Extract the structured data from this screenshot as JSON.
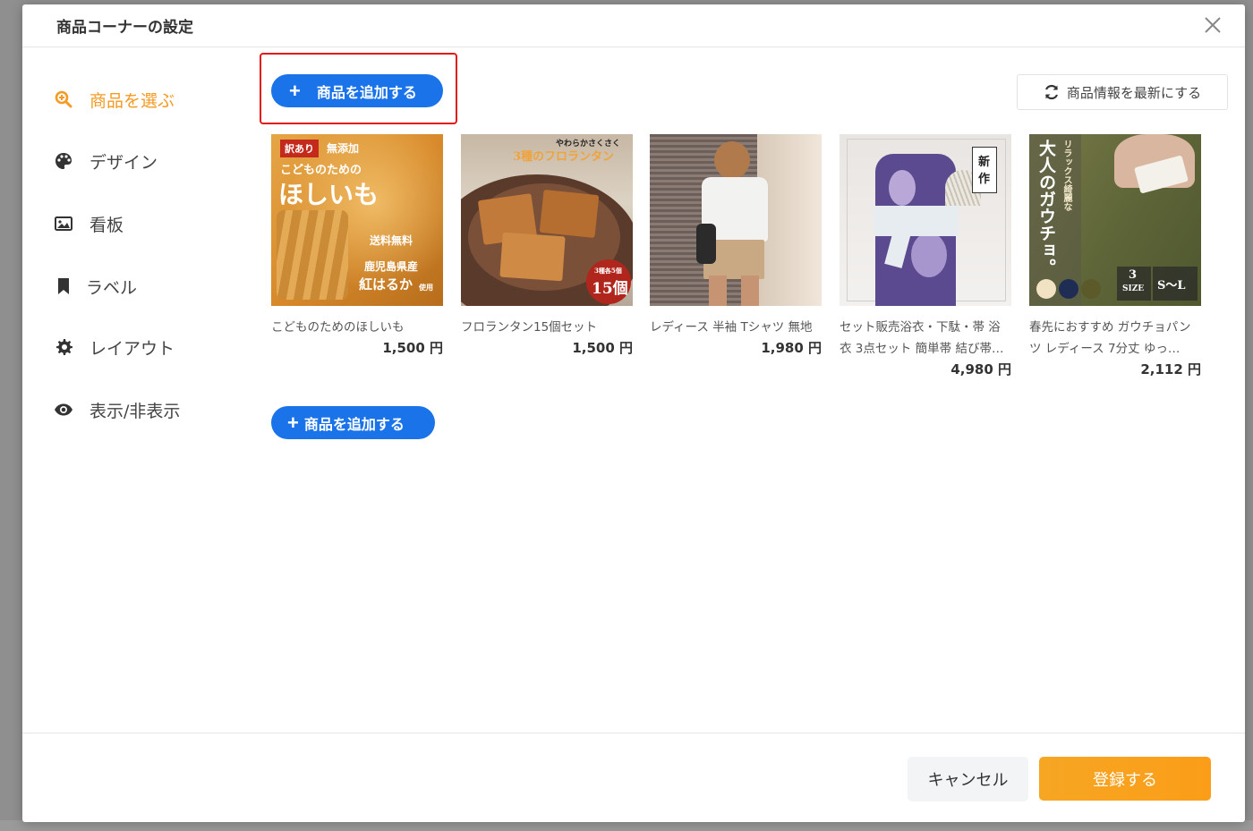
{
  "modal": {
    "title": "商品コーナーの設定"
  },
  "sidebar": {
    "items": [
      {
        "label": "商品を選ぶ",
        "icon": "search-plus-icon",
        "active": true
      },
      {
        "label": "デザイン",
        "icon": "palette-icon"
      },
      {
        "label": "看板",
        "icon": "image-icon"
      },
      {
        "label": "ラベル",
        "icon": "bookmark-icon"
      },
      {
        "label": "レイアウト",
        "icon": "gear-icon"
      },
      {
        "label": "表示/非表示",
        "icon": "eye-icon"
      }
    ]
  },
  "main": {
    "add_button_label": "商品を追加する",
    "refresh_label": "商品情報を最新にする",
    "products": [
      {
        "name": "こどものためのほしいも",
        "price": "1,500 円",
        "thumb": {
          "badge": "訳あり",
          "l1": "無添加",
          "l2": "こどものための",
          "l3": "ほしいも",
          "l4": "送料無料",
          "l5": "鹿児島県産",
          "l6": "紅はるか",
          "l7": "使用"
        }
      },
      {
        "name": "フロランタン15個セット",
        "price": "1,500 円",
        "thumb": {
          "l1": "やわらかさくさく",
          "l2": "3種のフロランタン",
          "l3": "3種各5個",
          "l4": "15個"
        }
      },
      {
        "name": "レディース 半袖 Tシャツ 無地",
        "price": "1,980 円",
        "thumb": {}
      },
      {
        "name": "セット販売浴衣・下駄・帯 浴衣 3点セット 簡単帯 結び帯…",
        "price": "4,980 円",
        "thumb": {
          "l1": "新",
          "l2": "作"
        }
      },
      {
        "name": "春先におすすめ ガウチョパンツ レディース 7分丈 ゆっ…",
        "price": "2,112 円",
        "thumb": {
          "l1": "リラックス綺麗な",
          "l2": "大人のガウチョ。",
          "l3": "3",
          "l4": "SIZE",
          "l5": "S〜L"
        }
      }
    ]
  },
  "footer": {
    "cancel_label": "キャンセル",
    "submit_label": "登録する"
  },
  "colors": {
    "accent": "#f59a23",
    "primary": "#1a73e8",
    "highlight": "#e21a1a"
  }
}
